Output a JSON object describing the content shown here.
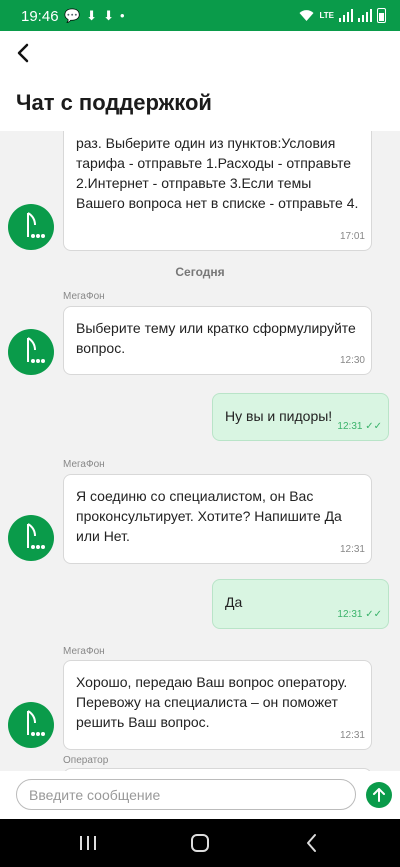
{
  "status": {
    "time": "19:46",
    "notifications": "💬⬇⬇•",
    "network": "LTE",
    "volte": "VoLTE"
  },
  "header": {
    "title": "Чат с поддержкой"
  },
  "feed": {
    "messages": [
      {
        "text": "раз. Выберите один из пунктов:Условия тарифа - отправьте 1.Расходы - отправьте 2.Интернет - отправьте 3.Если темы Вашего вопроса нет в списке - отправьте 4.",
        "time": "17:01"
      },
      {
        "date": "Сегодня"
      },
      {
        "sender": "МегаФон",
        "text": "Выберите тему или кратко сформулируйте вопрос.",
        "time": "12:30"
      },
      {
        "text": "Ну вы и пидоры!",
        "time": "12:31"
      },
      {
        "sender": "МегаФон",
        "text": "Я соединю со специалистом, он Вас проконсультирует. Хотите? Напишите Да или Нет.",
        "time": "12:31"
      },
      {
        "text": "Да",
        "time": "12:31"
      },
      {
        "sender": "МегаФон",
        "text": "Хорошо, передаю Ваш вопрос оператору. Перевожу на специалиста – он поможет решить Ваш вопрос.",
        "time": "12:31"
      },
      {
        "sender": "Оператор"
      }
    ]
  },
  "composer": {
    "placeholder": "Введите сообщение"
  },
  "colors": {
    "brand": "#0a9b4a",
    "outgoing_bg": "#d9f5e2"
  },
  "icons": {
    "back": "arrow-left-icon",
    "send": "arrow-up-icon",
    "avatar": "megafon-logo-icon",
    "nav": [
      "recent-apps-icon",
      "home-icon",
      "back-icon"
    ]
  }
}
